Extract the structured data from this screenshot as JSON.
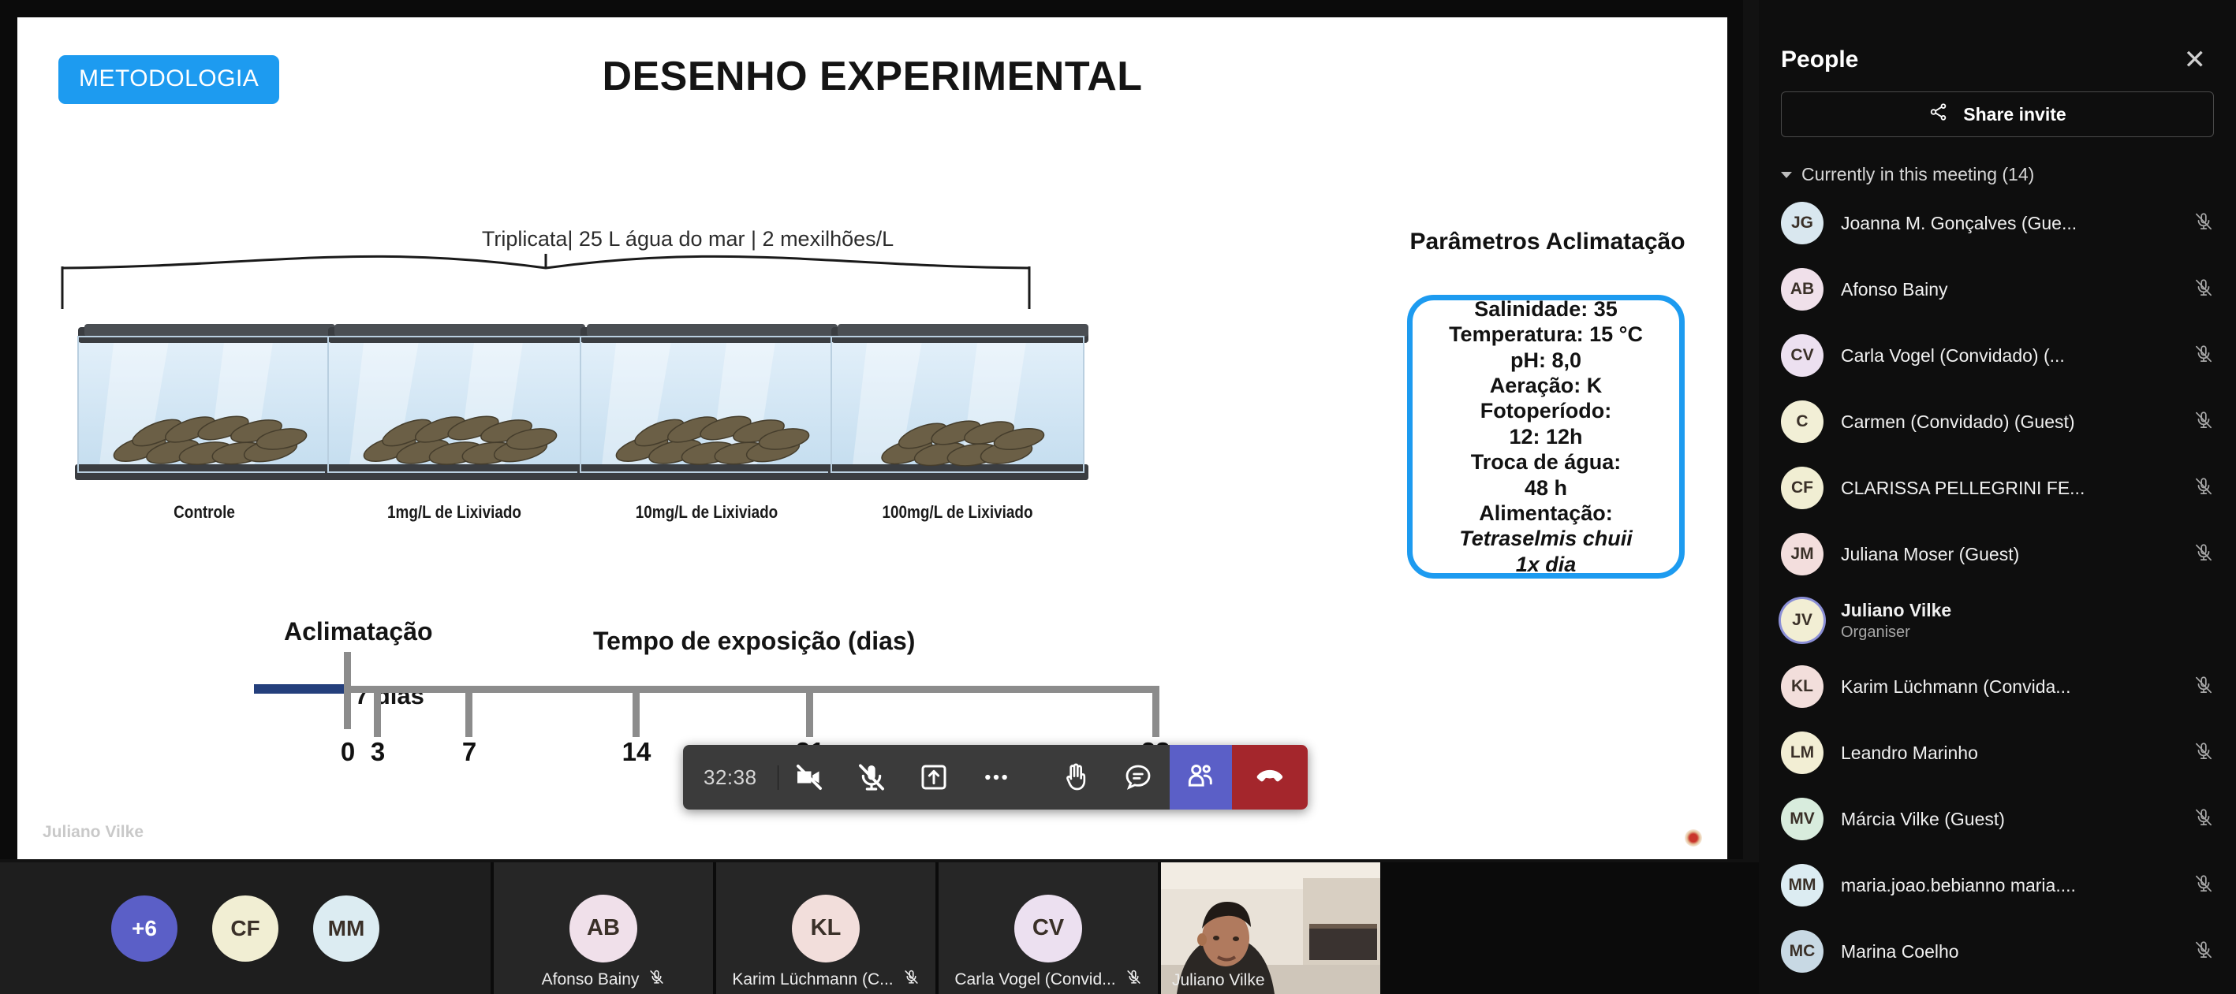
{
  "slide": {
    "badge": "METODOLOGIA",
    "title": "DESENHO EXPERIMENTAL",
    "bracket_note": "Triplicata| 25 L água do mar | 2 mexilhões/L",
    "tanks": [
      {
        "label": "Controle"
      },
      {
        "label": "1mg/L de Lixiviado"
      },
      {
        "label": "10mg/L de Lixiviado"
      },
      {
        "label": "100mg/L de Lixiviado"
      }
    ],
    "params": {
      "heading": "Parâmetros Aclimatação",
      "lines": [
        "Salinidade: 35",
        "Temperatura: 15 °C",
        "pH: 8,0",
        "Aeração: K",
        "Fotoperíodo:",
        "12: 12h",
        "Troca de água:",
        "48 h",
        "Alimentação:"
      ],
      "italic_lines": [
        "Tetraselmis chuii",
        "1x dia"
      ],
      "border_color": "#1d9bf0"
    },
    "timeline": {
      "acclimation_label": "Aclimatação",
      "acclimation_duration": "7 dias",
      "exposure_label": "Tempo de exposição (dias)",
      "ticks": [
        "0",
        "3",
        "7",
        "14",
        "21",
        "28"
      ],
      "acclimation_bar_color": "#243f7c",
      "axis_color": "#8c8c8c"
    },
    "watermark": "Juliano Vilke"
  },
  "toolbar": {
    "timer": "32:38",
    "buttons": [
      {
        "name": "camera-off-icon",
        "label": "Camera off"
      },
      {
        "name": "mic-off-icon",
        "label": "Mic off"
      },
      {
        "name": "share-screen-icon",
        "label": "Share screen"
      },
      {
        "name": "more-options-icon",
        "label": "More options"
      },
      {
        "name": "raise-hand-icon",
        "label": "Raise hand"
      },
      {
        "name": "chat-icon",
        "label": "Chat"
      },
      {
        "name": "people-icon",
        "label": "People"
      },
      {
        "name": "hang-up-icon",
        "label": "Leave"
      }
    ],
    "people_button_color": "#5b5fc7",
    "hangup_button_color": "#a4262c"
  },
  "people_panel": {
    "title": "People",
    "close_label": "✕",
    "share_invite_label": "Share invite",
    "share_icon": "share-icon",
    "section_label": "Currently in this meeting (14)",
    "participants": [
      {
        "initials": "JG",
        "name": "Joanna M. Gonçalves (Gue...",
        "role": "",
        "muted": true,
        "color": "#d9e7ef"
      },
      {
        "initials": "AB",
        "name": "Afonso Bainy",
        "role": "",
        "muted": true,
        "color": "#f0e0ea"
      },
      {
        "initials": "CV",
        "name": "Carla Vogel (Convidado) (...",
        "role": "",
        "muted": true,
        "color": "#ece0f0"
      },
      {
        "initials": "C",
        "name": "Carmen (Convidado) (Guest)",
        "role": "",
        "muted": true,
        "color": "#f2efd6"
      },
      {
        "initials": "CF",
        "name": "CLARISSA PELLEGRINI FE...",
        "role": "",
        "muted": true,
        "color": "#f1eed3"
      },
      {
        "initials": "JM",
        "name": "Juliana Moser (Guest)",
        "role": "",
        "muted": true,
        "color": "#f3dedd"
      },
      {
        "initials": "JV",
        "name": "Juliano Vilke",
        "role": "Organiser",
        "muted": false,
        "color": "#f2eed4",
        "highlighted": true
      },
      {
        "initials": "KL",
        "name": "Karim Lüchmann (Convida...",
        "role": "",
        "muted": true,
        "color": "#f2dedb"
      },
      {
        "initials": "LM",
        "name": "Leandro Marinho",
        "role": "",
        "muted": true,
        "color": "#f2eed4"
      },
      {
        "initials": "MV",
        "name": "Márcia Vilke (Guest)",
        "role": "",
        "muted": true,
        "color": "#d8ecdd"
      },
      {
        "initials": "MM",
        "name": "maria.joao.bebianno maria....",
        "role": "",
        "muted": true,
        "color": "#dcecf2"
      },
      {
        "initials": "MC",
        "name": "Marina Coelho",
        "role": "",
        "muted": true,
        "color": "#c8d9e4"
      }
    ]
  },
  "filmstrip": {
    "overflow_badge": "+6",
    "overflow_badge_color": "#5b5fc7",
    "overflow_avatars": [
      {
        "initials": "CF",
        "color": "#f1eed3"
      },
      {
        "initials": "MM",
        "color": "#dcecf2"
      }
    ],
    "tiles": [
      {
        "initials": "AB",
        "name": "Afonso Bainy",
        "muted": true,
        "color": "#f0e0ea",
        "video": false
      },
      {
        "initials": "KL",
        "name": "Karim Lüchmann (C...",
        "muted": true,
        "color": "#f2dedb",
        "video": false
      },
      {
        "initials": "CV",
        "name": "Carla Vogel (Convid...",
        "muted": true,
        "color": "#ece0f0",
        "video": false
      },
      {
        "initials": "JV",
        "name": "Juliano Vilke",
        "muted": false,
        "color": "#f2eed4",
        "video": true
      }
    ]
  }
}
